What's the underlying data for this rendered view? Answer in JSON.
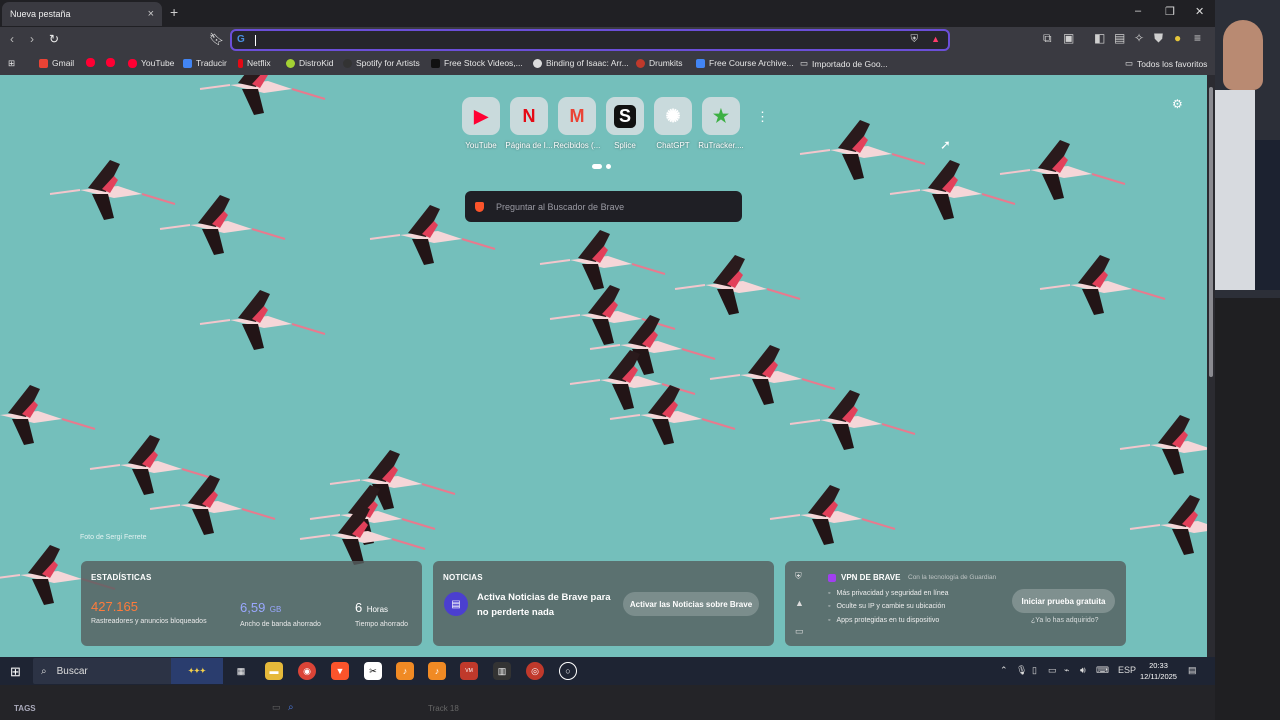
{
  "tab": {
    "title": "Nueva pestaña",
    "close": "×",
    "new": "+"
  },
  "window_controls": {
    "minimize": "–",
    "restore": "❐",
    "close": "✕"
  },
  "omnibox": {
    "placeholder": "",
    "engine_icon": "G"
  },
  "bookmarks": [
    {
      "label": "Gmail",
      "color": "#ea4335"
    },
    {
      "label": "",
      "color": "#ff0033"
    },
    {
      "label": "",
      "color": "#ff0033"
    },
    {
      "label": "YouTube",
      "color": "#ff0033"
    },
    {
      "label": "Traducir",
      "color": "#4285f4"
    },
    {
      "label": "Netflix",
      "color": "#e50914"
    },
    {
      "label": "DistroKid",
      "color": "#a4d233"
    },
    {
      "label": "Spotify for Artists",
      "color": "#333333"
    },
    {
      "label": "Free Stock Videos,...",
      "color": "#111111"
    },
    {
      "label": "Binding of Isaac: Arr...",
      "color": "#ddd"
    },
    {
      "label": "Drumkits",
      "color": "#c0392b"
    },
    {
      "label": "Free Course Archive...",
      "color": "#4285f4"
    },
    {
      "label": "Importado de Goo...",
      "color": "#ccc"
    }
  ],
  "bookmarks_right": "Todos los favoritos",
  "top_sites": [
    {
      "label": "YouTube",
      "icon": "▶",
      "color": "#ff0033"
    },
    {
      "label": "Página de I...",
      "icon": "N",
      "color": "#e50914"
    },
    {
      "label": "Recibidos (...",
      "icon": "M",
      "color": "#ea4335"
    },
    {
      "label": "Splice",
      "icon": "S",
      "color": "#111111"
    },
    {
      "label": "ChatGPT",
      "icon": "✺",
      "color": "#ffffff"
    },
    {
      "label": "RuTracker....",
      "icon": "★",
      "color": "#3cb043"
    }
  ],
  "search": {
    "placeholder": "Preguntar al Buscador de Brave"
  },
  "photo_credit": "Foto de Sergi Ferrete",
  "stats": {
    "title": "ESTADÍSTICAS",
    "trackers": {
      "value": "427.165",
      "label": "Rastreadores y anuncios bloqueados",
      "color": "#ff7b3b"
    },
    "bandwidth": {
      "value": "6,59",
      "unit": "GB",
      "label": "Ancho de banda ahorrado",
      "color": "#9aa8ff"
    },
    "time": {
      "value": "6",
      "unit": "Horas",
      "label": "Tiempo ahorrado",
      "color": "#ffffff"
    }
  },
  "news": {
    "title": "NOTICIAS",
    "text": "Activa Noticias de Brave para no perderte nada",
    "button": "Activar las Noticias sobre Brave"
  },
  "vpn": {
    "title": "VPN DE BRAVE",
    "by": "Con la tecnología de Guardian",
    "features": [
      "Más privacidad y seguridad en línea",
      "Oculte su IP y cambie su ubicación",
      "Apps protegidas en tu dispositivo"
    ],
    "button": "Iniciar prueba gratuita",
    "link": "¿Ya lo has adquirido?"
  },
  "taskbar": {
    "search_label": "Buscar",
    "language": "ESP",
    "time": "20:33",
    "date": "12/11/2025"
  },
  "daw": {
    "tags": "TAGS",
    "track": "Track 18"
  }
}
